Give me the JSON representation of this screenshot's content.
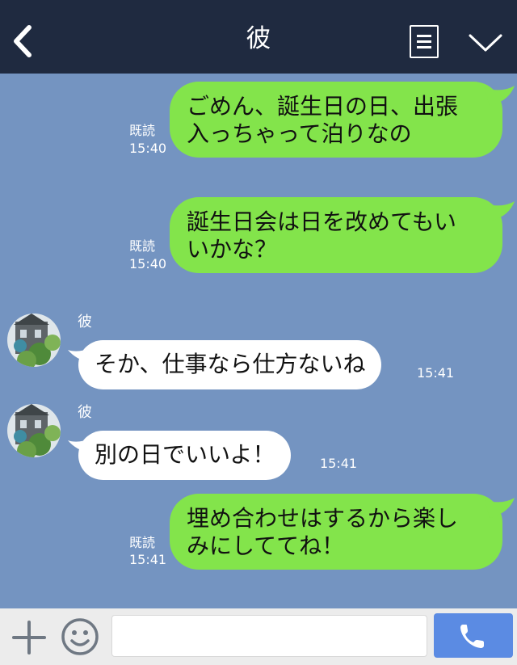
{
  "header": {
    "title": "彼",
    "back_icon": "back-arrow-icon",
    "menu_icon": "menu-icon",
    "collapse_icon": "chevron-down-icon",
    "background": "#1f2a40"
  },
  "chat": {
    "background": "#7494c1",
    "outgoing_bubble_color": "#83e44b",
    "incoming_bubble_color": "#ffffff",
    "messages": [
      {
        "direction": "out",
        "text_lines": [
          "ごめん、誕生日の日、出張",
          "入っちゃって泊りなの"
        ],
        "read": "既読",
        "time": "15:40"
      },
      {
        "direction": "out",
        "text_lines": [
          "誕生日会は日を改めてもい",
          "いかな？"
        ],
        "read": "既読",
        "time": "15:40"
      },
      {
        "direction": "in",
        "sender": "彼",
        "text": "そか、仕事なら仕方ないね",
        "time": "15:41"
      },
      {
        "direction": "in",
        "sender": "彼",
        "text": "別の日でいいよ！",
        "time": "15:41"
      },
      {
        "direction": "out",
        "text_lines": [
          "埋め合わせはするから楽し",
          "みにしててね！"
        ],
        "read": "既読",
        "time": "15:41"
      }
    ]
  },
  "footer": {
    "plus_icon": "plus-icon",
    "emoji_icon": "smiley-icon",
    "input_value": "",
    "input_placeholder": "",
    "call_icon": "phone-icon",
    "call_button_color": "#5b8be3"
  }
}
